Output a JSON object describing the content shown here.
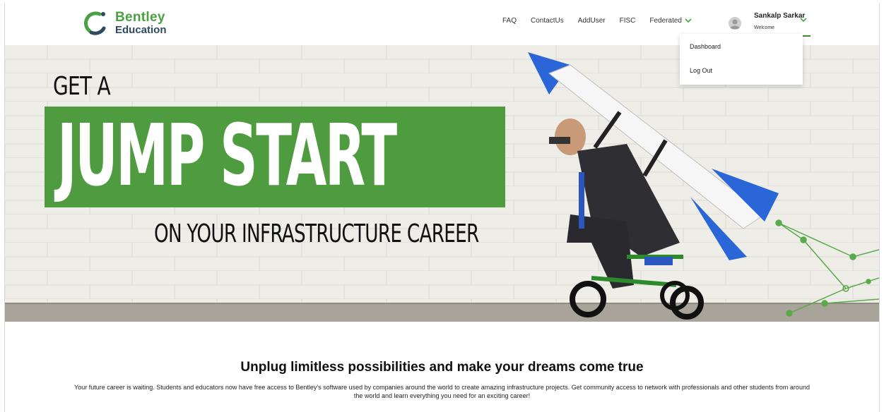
{
  "logo": {
    "line1": "Bentley",
    "line2": "Education"
  },
  "nav": {
    "faq": "FAQ",
    "contact": "ContactUs",
    "adduser": "AddUser",
    "fisc": "FISC",
    "federated": "Federated"
  },
  "user": {
    "name": "Sankalp Sarkar",
    "subtitle": "Welcome"
  },
  "dropdown": {
    "items": [
      "Dashboard",
      "Log Out"
    ]
  },
  "hero": {
    "line1": "GET A",
    "line2": "JUMP START",
    "line3": "ON YOUR INFRASTRUCTURE CAREER"
  },
  "content": {
    "headline": "Unplug limitless possibilities and make your dreams come true",
    "description": "Your future career is waiting. Students and educators now have free access to Bentley's software used by companies around the world to create amazing infrastructure projects. Get community access to network with professionals and other students from around the world and learn everything you need for an exciting career!"
  },
  "colors": {
    "brand_green": "#4aa042",
    "brand_navy": "#2d4a63",
    "band_green": "#4e9c3f",
    "rocket_blue": "#2a66d8"
  },
  "icons": [
    "bentley-logo-icon",
    "user-avatar-icon",
    "chevron-down-icon"
  ]
}
